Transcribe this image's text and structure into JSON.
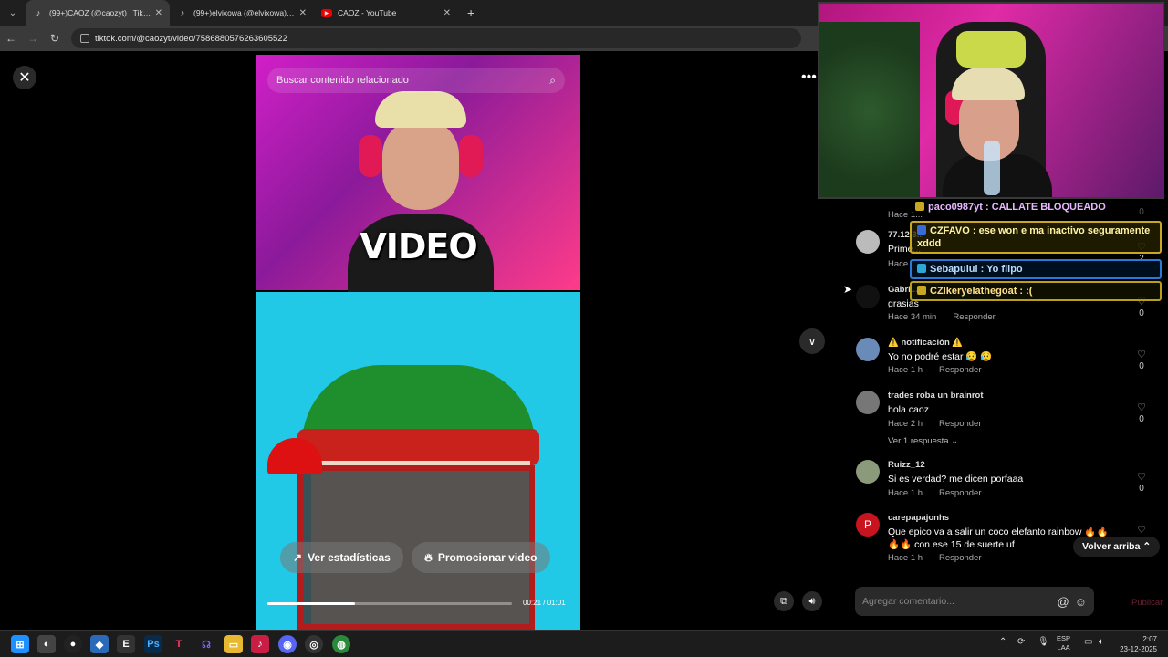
{
  "browser": {
    "tabs": [
      {
        "title": "(99+)CAOZ (@caozyt) | TikTok",
        "icon": "tiktok-icon",
        "active": true
      },
      {
        "title": "(99+)elvixowa (@elvixowa) | TikTok",
        "icon": "tiktok-icon",
        "active": false
      },
      {
        "title": "CAOZ - YouTube",
        "icon": "youtube-icon",
        "active": false
      }
    ],
    "url": "tiktok.com/@caozyt/video/7586880576263605522"
  },
  "video": {
    "search_placeholder": "Buscar contenido relacionado",
    "caption": "VIDEO",
    "stats_button": "Ver estadísticas",
    "promote_button": "Promocionar video",
    "progress_fraction": 0.36,
    "time": "00:21 / 01:01"
  },
  "comments": [
    {
      "user": "77.12.3...",
      "text": "Prime...",
      "time": "Hace...",
      "likes": "2",
      "avatar_letter": ""
    },
    {
      "user": "Gabri...",
      "text": "grasias",
      "time": "Hace 34 min",
      "reply": "Responder",
      "likes": "0",
      "avatar_letter": ""
    },
    {
      "user": "⚠️ notificación ⚠️",
      "text": "Yo no podré estar 😥 😥",
      "time": "Hace 1 h",
      "reply": "Responder",
      "likes": "0",
      "avatar_letter": ""
    },
    {
      "user": "trades roba un brainrot",
      "text": "hola caoz",
      "time": "Hace 2 h",
      "reply": "Responder",
      "likes": "0",
      "view_replies": "Ver 1 respuesta",
      "avatar_letter": ""
    },
    {
      "user": "Ruizz_12",
      "text": "Si es verdad? me dicen porfaaa",
      "time": "Hace 1 h",
      "reply": "Responder",
      "likes": "0",
      "avatar_letter": ""
    },
    {
      "user": "carepapajonhs",
      "text": "Que epico va a salir un coco elefanto rainbow 🔥🔥 🔥🔥 con ese 15 de suerte uf",
      "time": "Hace 1 h",
      "reply": "Responder",
      "likes": "",
      "avatar_letter": "P"
    }
  ],
  "top_comment_time": "Hace 1...",
  "top_comment_likes": "0",
  "back_to_top": "Volver arriba",
  "compose": {
    "placeholder": "Agregar comentario...",
    "publish": "Publicar"
  },
  "stream_chat": [
    {
      "user": "paco0987yt",
      "message": "CALLATE BLOQUEADO",
      "text": "paco0987yt : CALLATE BLOQUEADO"
    },
    {
      "user": "CZFAVO",
      "text": "CZFAVO : ese won e ma inactivo seguramente xddd"
    },
    {
      "user": "Sebapuiul",
      "text": "Sebapuiul : Yo flipo"
    },
    {
      "user": "CZIkeryelathegoat",
      "text": "CZIkeryelathegoat : :("
    }
  ],
  "taskbar": {
    "lang_top": "ESP",
    "lang_bottom": "LAA",
    "time": "2:07",
    "date": "23-12-2025"
  },
  "colors": {
    "accent": "#fe2c55",
    "tab_bg": "#1f1f1f",
    "address_bg": "#3a3a3a"
  }
}
